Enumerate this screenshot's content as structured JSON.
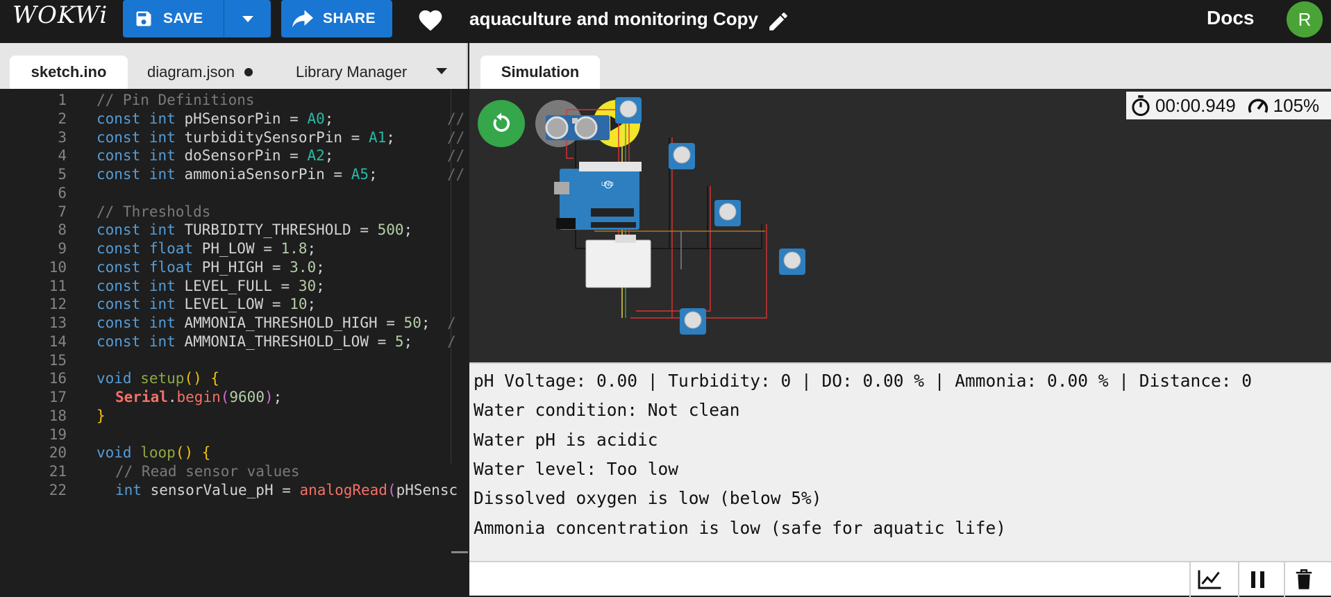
{
  "header": {
    "logo": "WOKWi",
    "save_label": "SAVE",
    "share_label": "SHARE",
    "project_title": "aquaculture and monitoring Copy",
    "docs_label": "Docs",
    "avatar_initial": "R"
  },
  "editor": {
    "tabs": [
      {
        "label": "sketch.ino",
        "active": true
      },
      {
        "label": "diagram.json",
        "active": false,
        "unsaved": true
      },
      {
        "label": "Library Manager",
        "active": false
      }
    ],
    "lines": [
      {
        "n": "1",
        "t": "// Pin Definitions",
        "tail": ""
      },
      {
        "n": "2",
        "t": "const int pHSensorPin = A0;",
        "tail": "//"
      },
      {
        "n": "3",
        "t": "const int turbiditySensorPin = A1;",
        "tail": "//"
      },
      {
        "n": "4",
        "t": "const int doSensorPin = A2;",
        "tail": "//"
      },
      {
        "n": "5",
        "t": "const int ammoniaSensorPin = A5;",
        "tail": "//"
      },
      {
        "n": "6",
        "t": "",
        "tail": ""
      },
      {
        "n": "7",
        "t": "// Thresholds",
        "tail": ""
      },
      {
        "n": "8",
        "t": "const int TURBIDITY_THRESHOLD = 500;",
        "tail": ""
      },
      {
        "n": "9",
        "t": "const float PH_LOW = 1.8;",
        "tail": ""
      },
      {
        "n": "10",
        "t": "const float PH_HIGH = 3.0;",
        "tail": ""
      },
      {
        "n": "11",
        "t": "const int LEVEL_FULL = 30;",
        "tail": ""
      },
      {
        "n": "12",
        "t": "const int LEVEL_LOW = 10;",
        "tail": ""
      },
      {
        "n": "13",
        "t": "const int AMMONIA_THRESHOLD_HIGH = 50;",
        "tail": "/"
      },
      {
        "n": "14",
        "t": "const int AMMONIA_THRESHOLD_LOW = 5;",
        "tail": "/"
      },
      {
        "n": "15",
        "t": "",
        "tail": ""
      },
      {
        "n": "16",
        "t": "void setup() {",
        "tail": ""
      },
      {
        "n": "17",
        "t": "Serial.begin(9600);",
        "tail": ""
      },
      {
        "n": "18",
        "t": "}",
        "tail": ""
      },
      {
        "n": "19",
        "t": "",
        "tail": ""
      },
      {
        "n": "20",
        "t": "void loop() {",
        "tail": ""
      },
      {
        "n": "21",
        "t": "// Read sensor values",
        "tail": ""
      },
      {
        "n": "22",
        "t": "int sensorValue_pH = analogRead(pHSensc",
        "tail": ""
      }
    ]
  },
  "simulation": {
    "tab_label": "Simulation",
    "timer": "00:00.949",
    "speed": "105%"
  },
  "serial": {
    "lines": [
      "pH Voltage: 0.00 | Turbidity: 0 | DO: 0.00 % | Ammonia: 0.00 % | Distance: 0",
      "Water condition: Not clean",
      "Water pH is acidic",
      "Water level: Too low",
      "Dissolved oxygen is low (below 5%)",
      "Ammonia concentration is low (safe for aquatic life)"
    ]
  },
  "colors": {
    "topbar": "#1b1b1b",
    "button_blue": "#1976d2",
    "restart_green": "#35a64a",
    "stop_gray": "#7a7a7a",
    "play_yellow": "#f2e52a",
    "avatar_green": "#4aa336"
  },
  "icons": [
    "save-icon",
    "chevron-down-icon",
    "share-arrow-icon",
    "heart-icon",
    "pencil-icon",
    "restart-icon",
    "stop-icon",
    "play-icon",
    "stopwatch-icon",
    "speedometer-icon",
    "chart-icon",
    "pause-icon",
    "trash-icon"
  ]
}
